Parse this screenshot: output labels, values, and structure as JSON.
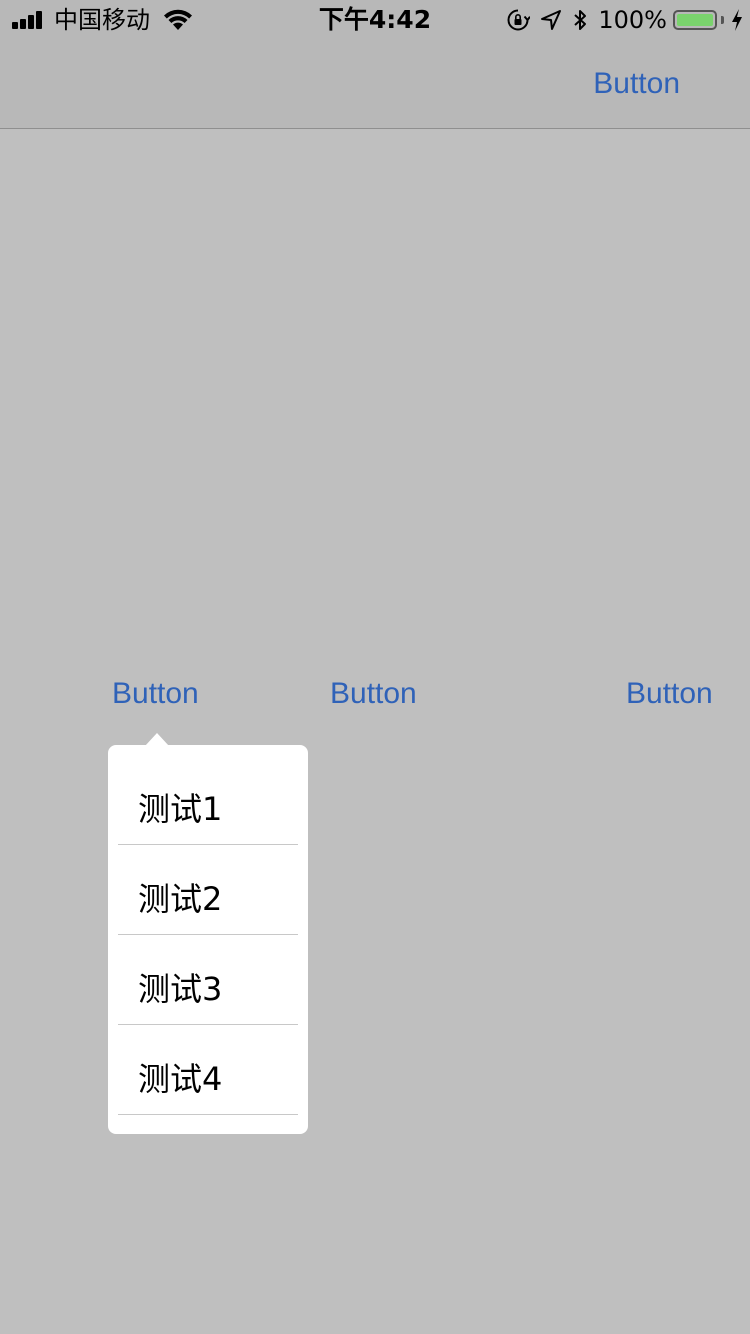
{
  "status_bar": {
    "carrier": "中国移动",
    "time": "下午4:42",
    "battery_percent": "100%",
    "battery_level": 1.0,
    "battery_color": "#7ad36d"
  },
  "nav_bar": {
    "right_button_label": "Button"
  },
  "main": {
    "buttons": [
      {
        "label": "Button"
      },
      {
        "label": "Button"
      },
      {
        "label": "Button"
      }
    ]
  },
  "popover": {
    "items": [
      {
        "label": "测试1"
      },
      {
        "label": "测试2"
      },
      {
        "label": "测试3"
      },
      {
        "label": "测试4"
      }
    ]
  },
  "colors": {
    "accent": "#2f62b8",
    "background": "#bfbfbf",
    "bar_background": "#b8b8b8"
  }
}
